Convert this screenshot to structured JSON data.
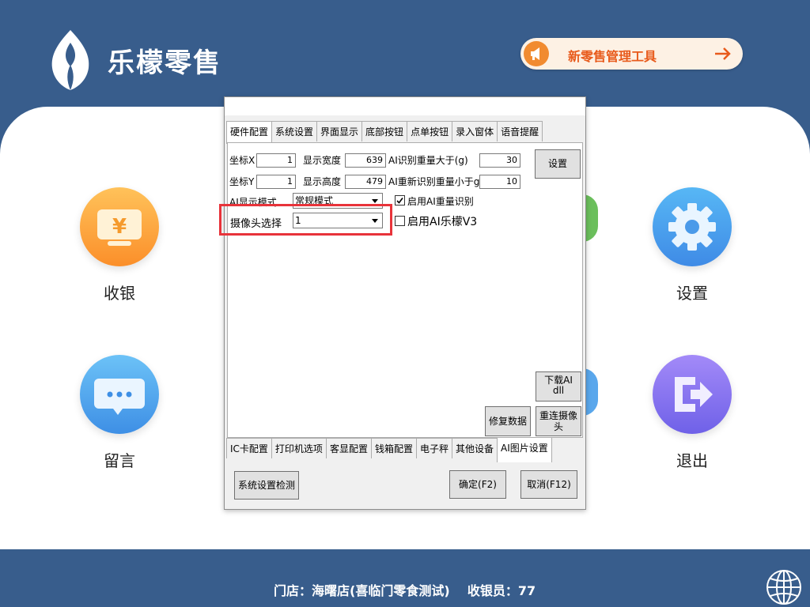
{
  "app": {
    "brand": "乐檬零售",
    "promo_label": "新零售管理工具"
  },
  "tiles": {
    "cashier": "收银",
    "settings": "设置",
    "message": "留言",
    "exit": "退出"
  },
  "footer": {
    "store_text": "门店：海曙店(喜临门零食测试)    收银员：77"
  },
  "dialog": {
    "tabs_top": [
      "硬件配置",
      "系统设置",
      "界面显示",
      "底部按钮",
      "点单按钮",
      "录入窗体",
      "语音提醒"
    ],
    "tabs_bottom": [
      "IC卡配置",
      "打印机选项",
      "客显配置",
      "钱箱配置",
      "电子秤",
      "其他设备",
      "AI图片设置"
    ],
    "fields": {
      "coord_x_label": "坐标X",
      "coord_x": "1",
      "coord_y_label": "坐标Y",
      "coord_y": "1",
      "width_label": "显示宽度",
      "width": "639",
      "height_label": "显示高度",
      "height": "479",
      "ai_weight_gt_label": "AI识别重量大于(g)",
      "ai_weight_gt": "30",
      "ai_reweight_lt_label": "AI重新识别重量小于g",
      "ai_reweight_lt": "10",
      "display_mode_label": "AI显示模式",
      "display_mode": "常规模式",
      "ai_weight_recog_label": "启用AI重量识别",
      "camera_label": "摄像头选择",
      "camera": "1",
      "ai_v3_label": "启用AI乐檬V3"
    },
    "buttons": {
      "set": "设置",
      "download_ai": "下载AI\ndll",
      "repair": "修复数据",
      "reconnect": "重连摄像\n头",
      "check": "系统设置检测",
      "ok": "确定(F2)",
      "cancel": "取消(F12)"
    },
    "ai_weight_checked": true,
    "ai_v3_checked": false
  },
  "colors": {
    "brand_blue": "#385d8c",
    "highlight": "#e8333a",
    "promo_text": "#e85a1b"
  }
}
